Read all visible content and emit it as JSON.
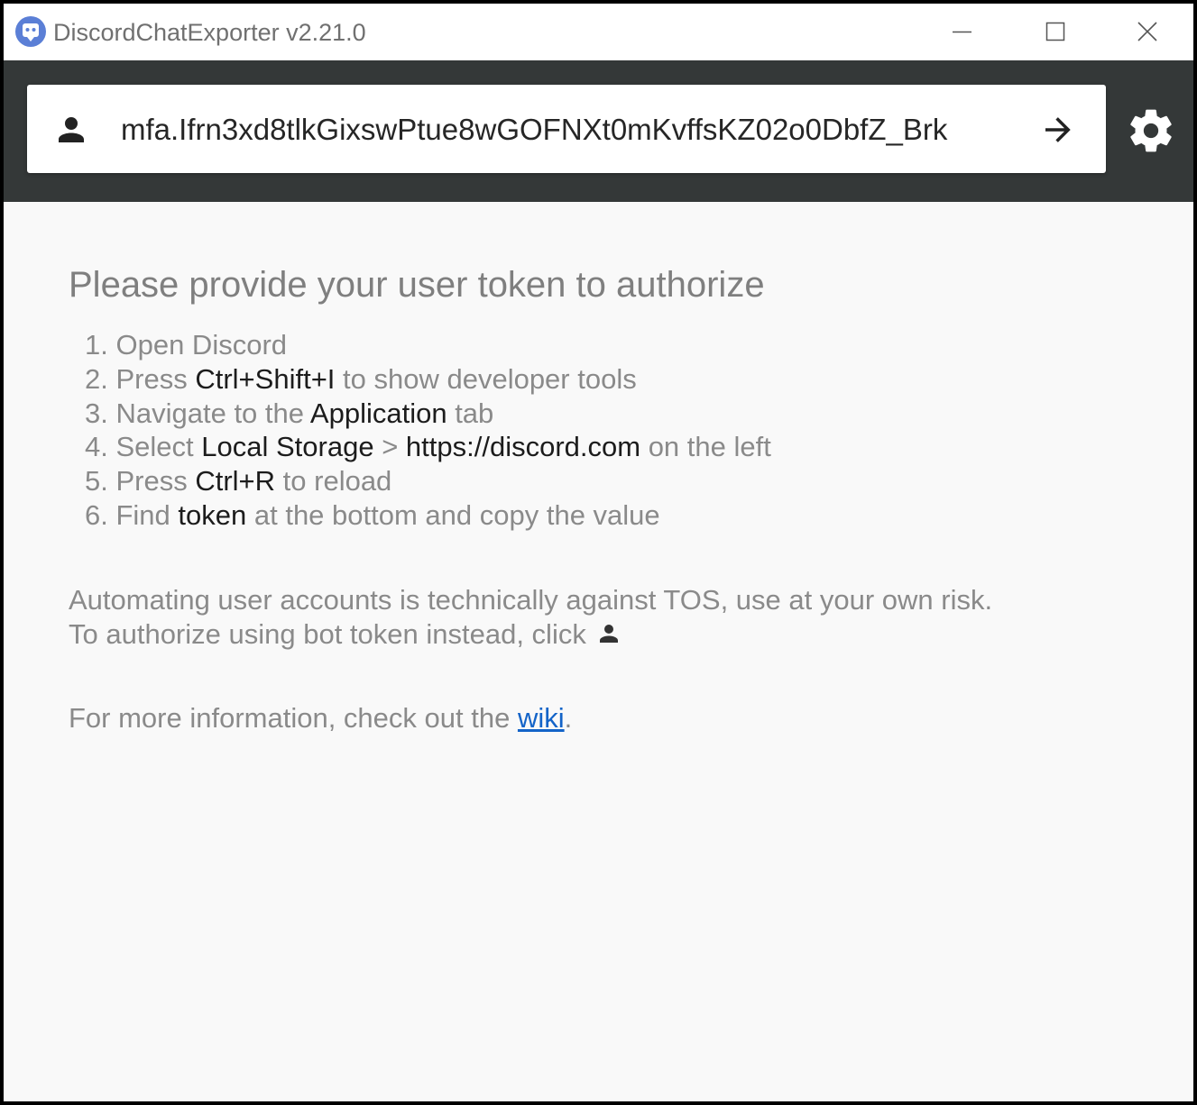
{
  "window": {
    "title": "DiscordChatExporter v2.21.0",
    "controls": {
      "minimize": "minimize-icon",
      "maximize": "maximize-icon",
      "close": "close-icon"
    }
  },
  "toolbar": {
    "token_value": "mfa.Ifrn3xd8tlkGixswPtue8wGOFNXt0mKvffsKZ02o0DbfZ_Brk",
    "icons": {
      "account": "account-icon",
      "submit": "arrow-right-icon",
      "settings": "gear-icon"
    },
    "background_color": "#343838"
  },
  "content": {
    "heading": "Please provide your user token to authorize",
    "steps": {
      "s1_num": "1.",
      "s1_a": "Open Discord",
      "s2_num": "2.",
      "s2_a": "Press ",
      "s2_b": "Ctrl+Shift+I",
      "s2_c": " to show developer tools",
      "s3_num": "3.",
      "s3_a": "Navigate to the ",
      "s3_b": "Application",
      "s3_c": " tab",
      "s4_num": "4.",
      "s4_a": "Select ",
      "s4_b": "Local Storage",
      "s4_c": " > ",
      "s4_d": "https://discord.com",
      "s4_e": " on the left",
      "s5_num": "5.",
      "s5_a": "Press ",
      "s5_b": "Ctrl+R",
      "s5_c": " to reload",
      "s6_num": "6.",
      "s6_a": "Find ",
      "s6_b": "token",
      "s6_c": " at the bottom and copy the value"
    },
    "tos_warning": "Automating user accounts is technically against TOS, use at your own risk.",
    "bot_hint": "To authorize using bot token instead, click",
    "more_info_prefix": "For more information, check out the ",
    "wiki_link": "wiki",
    "more_info_suffix": ".",
    "link_color": "#1464c8"
  }
}
